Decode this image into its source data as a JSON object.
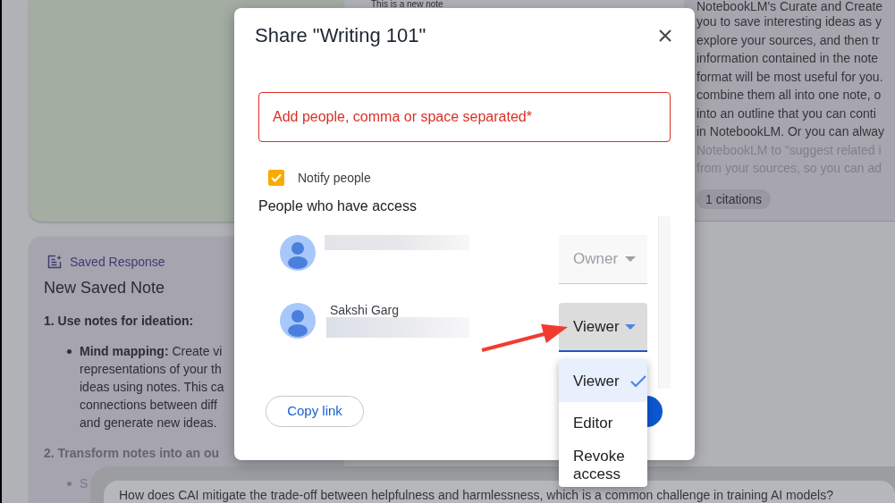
{
  "background": {
    "left_notes": [
      {
        "color": "#a3ada2"
      },
      {
        "color": "#a6a4ae",
        "label": "Saved Response",
        "title": "New Saved Note",
        "blocks": [
          {
            "kind": "heading",
            "text": "1. Use notes for ideation:",
            "faded": false
          },
          {
            "kind": "bullet",
            "lines": [
              "**Mind mapping:** Create vi",
              "representations of your th",
              "ideas using notes. This ca",
              "connections between diff",
              "and generate new ideas."
            ],
            "faded": false
          },
          {
            "kind": "heading",
            "text": "2. Transform notes into an ou",
            "faded": true
          },
          {
            "kind": "bullet",
            "lines": [
              "S"
            ],
            "faded": true
          }
        ]
      }
    ],
    "middle_note": {
      "text": "This is a new note"
    },
    "right_note": {
      "lines": [
        {
          "text": "NotebookLM's Curate and Create",
          "faded": false
        },
        {
          "text": "you to save interesting ideas as y",
          "faded": false
        },
        {
          "text": "explore your sources, and then tr",
          "faded": false
        },
        {
          "text": "information contained in the note",
          "faded": false
        },
        {
          "text": "format will be most useful for you.",
          "faded": false
        },
        {
          "text": "combine them all into one note, o",
          "faded": false
        },
        {
          "text": "into an outline that you can conti",
          "faded": false
        },
        {
          "text": "in NotebookLM. Or you can alway",
          "faded": false
        },
        {
          "text": "NotebookLM to \"suggest related i",
          "faded": true
        },
        {
          "text": "from your sources, so you can ad",
          "faded": true
        }
      ],
      "chip": "1 citations"
    },
    "suggested_question": "How does CAI mitigate the trade-off between helpfulness and harmlessness, which is a common challenge in training AI models?"
  },
  "dialog": {
    "title": "Share \"Writing 101\"",
    "input": {
      "placeholder": "Add people, comma or space separated*"
    },
    "notify": {
      "label": "Notify people",
      "checked": true
    },
    "section_title": "People who have access",
    "people": [
      {
        "role": "Owner",
        "disabled": true,
        "open": false
      },
      {
        "name": "Sakshi Garg",
        "role": "Viewer",
        "disabled": false,
        "open": true
      }
    ],
    "copy_link": "Copy link"
  },
  "role_menu": {
    "options": [
      {
        "label": "Viewer",
        "selected": true
      },
      {
        "label": "Editor",
        "selected": false
      },
      {
        "label": "Revoke access",
        "selected": false
      }
    ]
  }
}
